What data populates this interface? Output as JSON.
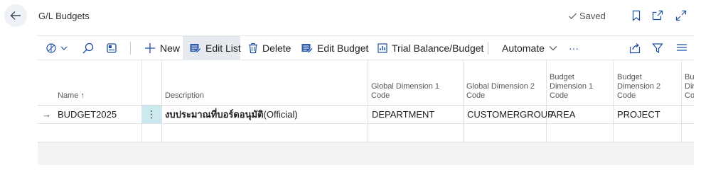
{
  "header": {
    "title": "G/L Budgets",
    "saved_label": "Saved",
    "icons": [
      "back-arrow-icon",
      "bookmark-icon",
      "open-new-window-icon",
      "expand-icon"
    ]
  },
  "toolbar": {
    "new_label": "New",
    "edit_list_label": "Edit List",
    "delete_label": "Delete",
    "edit_budget_label": "Edit Budget",
    "trial_balance_label": "Trial Balance/Budget",
    "automate_label": "Automate",
    "more_label": "···",
    "icons": [
      "analysis-icon",
      "search-icon",
      "filter-pane-icon",
      "share-icon",
      "filter-icon",
      "list-view-icon"
    ]
  },
  "table": {
    "columns": {
      "name": "Name ↑",
      "description": "Description",
      "gd1_line1": "Global Dimension 1",
      "gd1_line2": "Code",
      "gd2_line1": "Global Dimension 2",
      "gd2_line2": "Code",
      "bd1_line1": "Budget",
      "bd1_line2": "Dimension 1",
      "bd1_line3": "Code",
      "bd2_line1": "Budget",
      "bd2_line2": "Dimension 2",
      "bd2_line3": "Code",
      "bd3_line1": "Bu",
      "bd3_line2": "Dir",
      "bd3_line3": "Co"
    },
    "rows": [
      {
        "name": "BUDGET2025",
        "description_thai": "งบประมาณที่บอร์ดอนุมัติ",
        "description_rest": " (Official)",
        "gd1": "DEPARTMENT",
        "gd2": "CUSTOMERGROUP",
        "bd1": "AREA",
        "bd2": "PROJECT"
      }
    ],
    "kebab": "⋮",
    "row_arrow": "→"
  },
  "colors": {
    "accent": "#1e4fa0",
    "selected_cell": "#cce9f0",
    "background_panel": "#f3f3f4"
  }
}
